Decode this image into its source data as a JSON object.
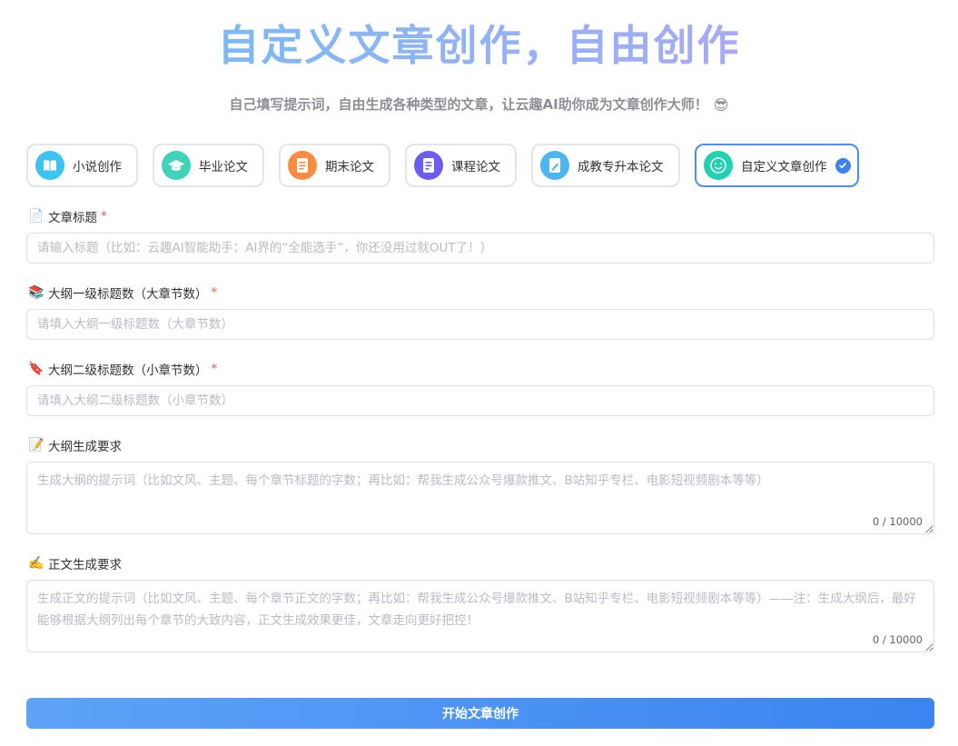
{
  "header": {
    "title": "自定义文章创作，自由创作",
    "subtitle": "自己填写提示词，自由生成各种类型的文章，让云趣AI助你成为文章创作大师！",
    "subtitle_emoji": "😎"
  },
  "tabs": [
    {
      "label": "小说创作",
      "icon": "book-icon",
      "color": "#3cc3f0"
    },
    {
      "label": "毕业论文",
      "icon": "graduation-cap-icon",
      "color": "#3fd3b9"
    },
    {
      "label": "期末论文",
      "icon": "document-icon",
      "color": "#fb8c3e"
    },
    {
      "label": "课程论文",
      "icon": "notes-icon",
      "color": "#6e5cf0"
    },
    {
      "label": "成教专升本论文",
      "icon": "edit-note-icon",
      "color": "#4cb6f2"
    },
    {
      "label": "自定义文章创作",
      "icon": "smile-icon",
      "color": "#20d2b0",
      "selected": true
    }
  ],
  "form": {
    "title_field": {
      "emoji": "📄",
      "label": "文章标题",
      "required_mark": "*",
      "placeholder": "请输入标题（比如：云趣AI智能助手：AI界的“全能选手”，你还没用过就OUT了！）",
      "value": ""
    },
    "level1_field": {
      "emoji": "📚",
      "label": "大纲一级标题数（大章节数）",
      "required_mark": "*",
      "placeholder": "请填入大纲一级标题数（大章节数）",
      "value": ""
    },
    "level2_field": {
      "emoji": "🔖",
      "label": "大纲二级标题数（小章节数）",
      "required_mark": "*",
      "placeholder": "请填入大纲二级标题数（小章节数）",
      "value": ""
    },
    "outline_req": {
      "emoji": "📝",
      "label": "大纲生成要求",
      "placeholder": "生成大纲的提示词（比如文风、主题、每个章节标题的字数；再比如：帮我生成公众号爆款推文、B站知乎专栏、电影短视频剧本等等）",
      "counter": "0 / 10000",
      "value": ""
    },
    "body_req": {
      "emoji": "✍️",
      "label": "正文生成要求",
      "placeholder": "生成正文的提示词（比如文风、主题、每个章节正文的字数；再比如：帮我生成公众号爆款推文、B站知乎专栏、电影短视频剧本等等）——注：生成大纲后，最好能够根据大纲列出每个章节的大致内容，正文生成效果更佳，文章走向更好把控！",
      "counter": "0 / 10000",
      "value": ""
    },
    "submit_label": "开始文章创作"
  },
  "colors": {
    "accent": "#3d82f0",
    "required": "#f05050",
    "placeholder": "#b8bcc4"
  }
}
